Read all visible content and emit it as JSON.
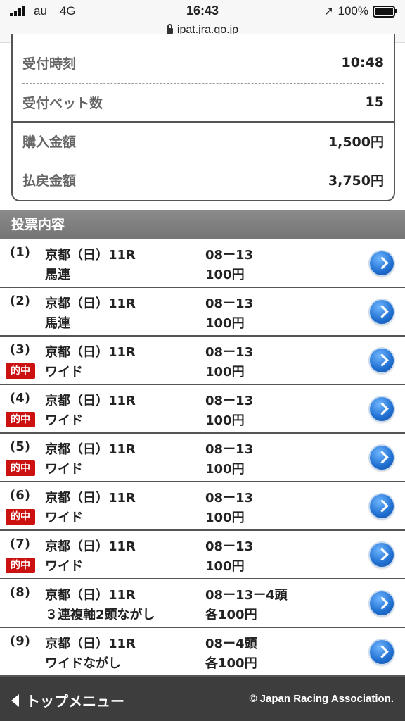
{
  "status_bar": {
    "carrier": "au",
    "network": "4G",
    "time": "16:43",
    "battery": "100%"
  },
  "browser": {
    "url": "ipat.jra.go.jp"
  },
  "summary": [
    {
      "label": "受付時刻",
      "value": "10:48"
    },
    {
      "label": "受付ベット数",
      "value": "15"
    },
    {
      "label": "購入金額",
      "value": "1,500円"
    },
    {
      "label": "払戻金額",
      "value": "3,750円"
    }
  ],
  "section_title": "投票内容",
  "hit_label": "的中",
  "tickets": [
    {
      "num": "(1)",
      "race": "京都（日）11R",
      "type": "馬連",
      "combo": "08ー13",
      "amount": "100円",
      "hit": false
    },
    {
      "num": "(2)",
      "race": "京都（日）11R",
      "type": "馬連",
      "combo": "08ー13",
      "amount": "100円",
      "hit": false
    },
    {
      "num": "(3)",
      "race": "京都（日）11R",
      "type": "ワイド",
      "combo": "08ー13",
      "amount": "100円",
      "hit": true
    },
    {
      "num": "(4)",
      "race": "京都（日）11R",
      "type": "ワイド",
      "combo": "08ー13",
      "amount": "100円",
      "hit": true
    },
    {
      "num": "(5)",
      "race": "京都（日）11R",
      "type": "ワイド",
      "combo": "08ー13",
      "amount": "100円",
      "hit": true
    },
    {
      "num": "(6)",
      "race": "京都（日）11R",
      "type": "ワイド",
      "combo": "08ー13",
      "amount": "100円",
      "hit": true
    },
    {
      "num": "(7)",
      "race": "京都（日）11R",
      "type": "ワイド",
      "combo": "08ー13",
      "amount": "100円",
      "hit": true
    },
    {
      "num": "(8)",
      "race": "京都（日）11R",
      "type": "３連複軸2頭ながし",
      "combo": "08ー13ー4頭",
      "amount": "各100円",
      "hit": false
    },
    {
      "num": "(9)",
      "race": "京都（日）11R",
      "type": "ワイドながし",
      "combo": "08ー4頭",
      "amount": "各100円",
      "hit": false
    }
  ],
  "footer": {
    "top_menu": "トップメニュー",
    "copyright": "© Japan Racing Association."
  }
}
